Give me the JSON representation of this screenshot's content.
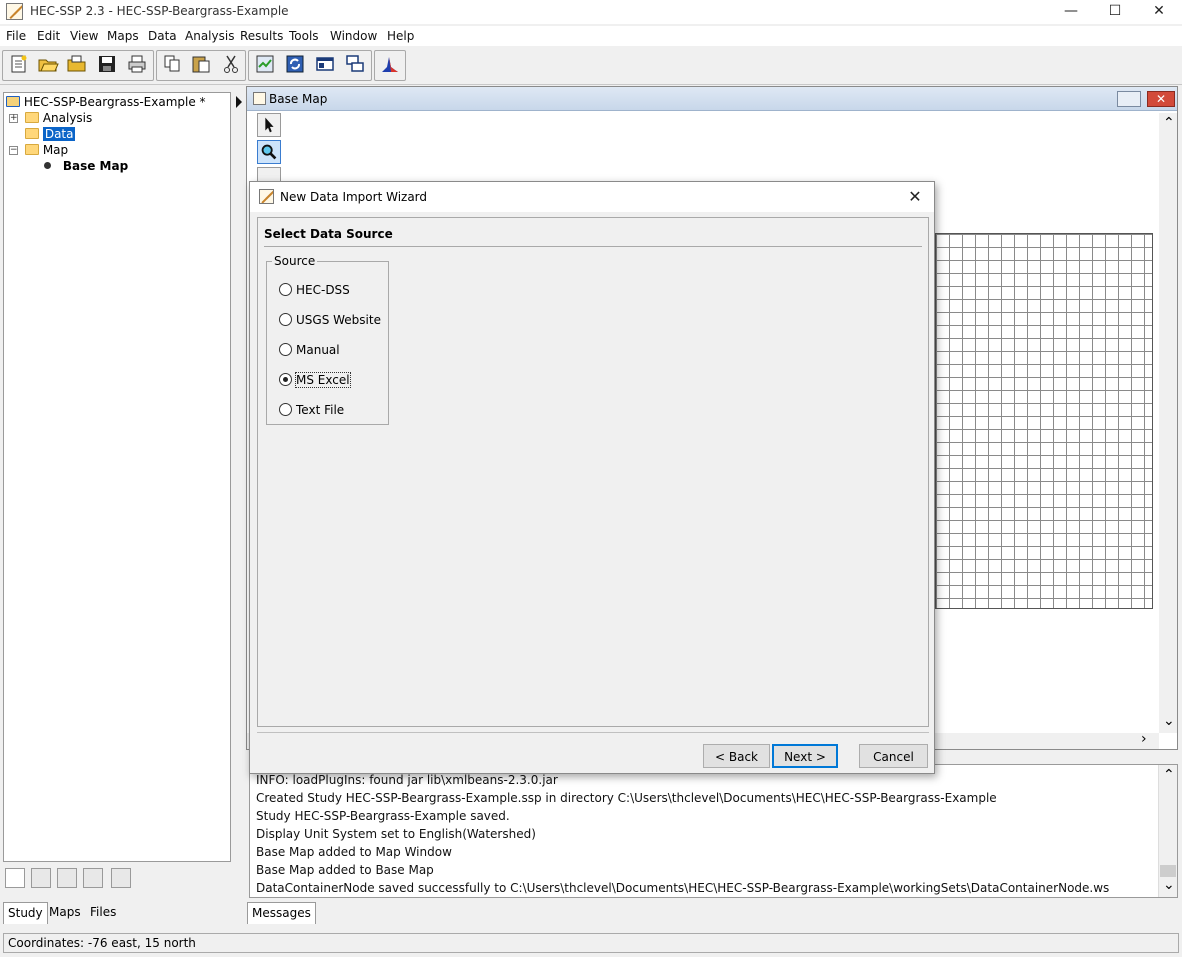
{
  "window": {
    "title": "HEC-SSP 2.3 - HEC-SSP-Beargrass-Example",
    "controls": {
      "minimize": "—",
      "maximize": "☐",
      "close": "✕"
    }
  },
  "menu": [
    "File",
    "Edit",
    "View",
    "Maps",
    "Data",
    "Analysis",
    "Results",
    "Tools",
    "Window",
    "Help"
  ],
  "toolbar": {
    "icons": [
      "new-study-icon",
      "open-study-icon",
      "open-folder-icon",
      "save-icon",
      "print-icon",
      "copy-icon",
      "paste-icon",
      "cut-icon",
      "import-data-icon",
      "refresh-icon",
      "window-layout-icon",
      "cascade-icon",
      "chart-icon"
    ]
  },
  "tree": {
    "root": "HEC-SSP-Beargrass-Example *",
    "nodes": [
      {
        "label": "Analysis",
        "expander": "+"
      },
      {
        "label": "Data",
        "expander": "",
        "selected": true
      },
      {
        "label": "Map",
        "expander": "−"
      }
    ],
    "map_child": "Base Map"
  },
  "left_tabs": [
    "Study",
    "Maps",
    "Files"
  ],
  "map_window": {
    "title": "Base Map"
  },
  "messages": {
    "tab": "Messages",
    "lines": [
      "INFO: loadPlugIns: found jar lib\\xmlbeans-2.3.0.jar",
      "Created Study HEC-SSP-Beargrass-Example.ssp in directory C:\\Users\\thclevel\\Documents\\HEC\\HEC-SSP-Beargrass-Example",
      "Study HEC-SSP-Beargrass-Example saved.",
      "Display Unit System set to English(Watershed)",
      "Base Map added to Map Window",
      "Base Map added to Base Map",
      "DataContainerNode saved successfully to C:\\Users\\thclevel\\Documents\\HEC\\HEC-SSP-Beargrass-Example\\workingSets\\DataContainerNode.ws"
    ]
  },
  "status": {
    "text": "Coordinates: -76 east, 15 north"
  },
  "dialog": {
    "title": "New Data Import Wizard",
    "close": "✕",
    "heading": "Select Data Source",
    "group_label": "Source",
    "options": [
      "HEC-DSS",
      "USGS Website",
      "Manual",
      "MS Excel",
      "Text File"
    ],
    "selected": "MS Excel",
    "buttons": {
      "back": "< Back",
      "next": "Next >",
      "cancel": "Cancel"
    }
  },
  "scroll_arrows": {
    "up": "⌃",
    "down": "⌄",
    "right": "›"
  }
}
